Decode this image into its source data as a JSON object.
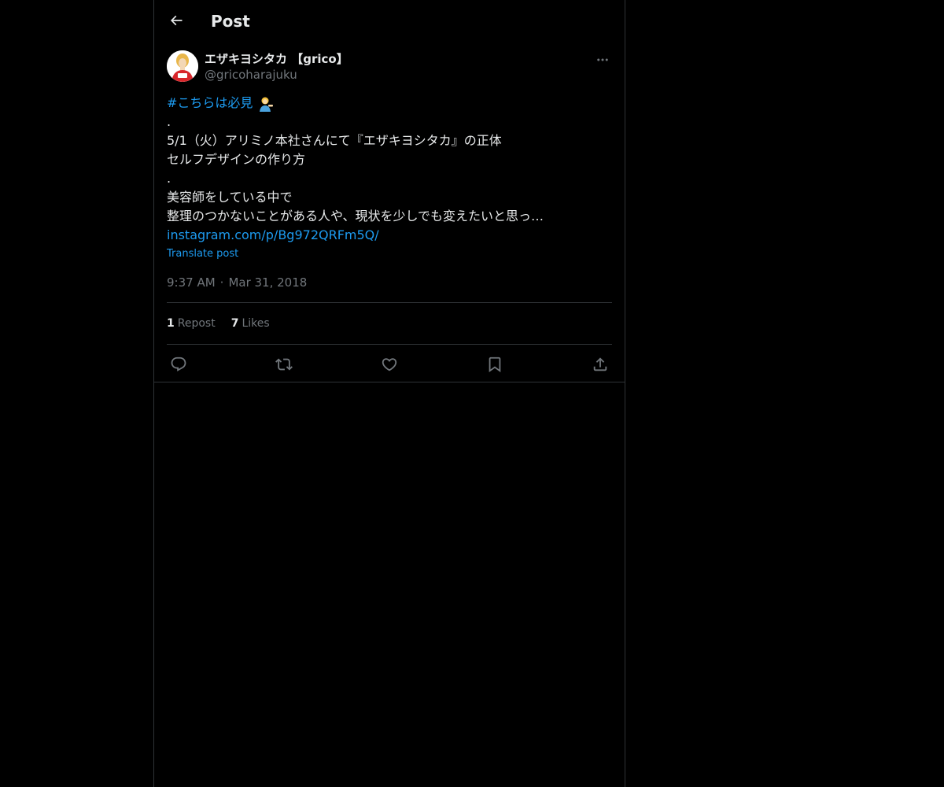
{
  "header": {
    "title": "Post"
  },
  "tweet": {
    "author_name": "エザキヨシタカ 【grico】",
    "author_handle": "@gricoharajuku",
    "avatar_label": "grico",
    "hashtag": "#こちらは必見",
    "lines": [
      ".",
      "5/1（火）アリミノ本社さんにて『エザキヨシタカ』の正体",
      "セルフデザインの作り方",
      ".",
      "美容師をしている中で",
      "整理のつかないことがある人や、現状を少しでも変えたいと思っ…"
    ],
    "link": "instagram.com/p/Bg972QRFm5Q/",
    "translate_label": "Translate post",
    "time": "9:37 AM",
    "separator": "·",
    "date": "Mar 31, 2018"
  },
  "stats": {
    "reposts_count": "1",
    "reposts_label": "Repost",
    "likes_count": "7",
    "likes_label": "Likes"
  },
  "colors": {
    "background": "#000000",
    "text": "#e7e9ea",
    "muted": "#71767b",
    "accent": "#1d9bf0",
    "border": "#2f3336"
  },
  "icons": {
    "back": "arrow-left-icon",
    "more": "more-horizontal-icon",
    "reply": "reply-icon",
    "repost": "repost-icon",
    "like": "heart-icon",
    "bookmark": "bookmark-icon",
    "share": "share-icon",
    "emoji": "person-tipping-hand-emoji"
  }
}
